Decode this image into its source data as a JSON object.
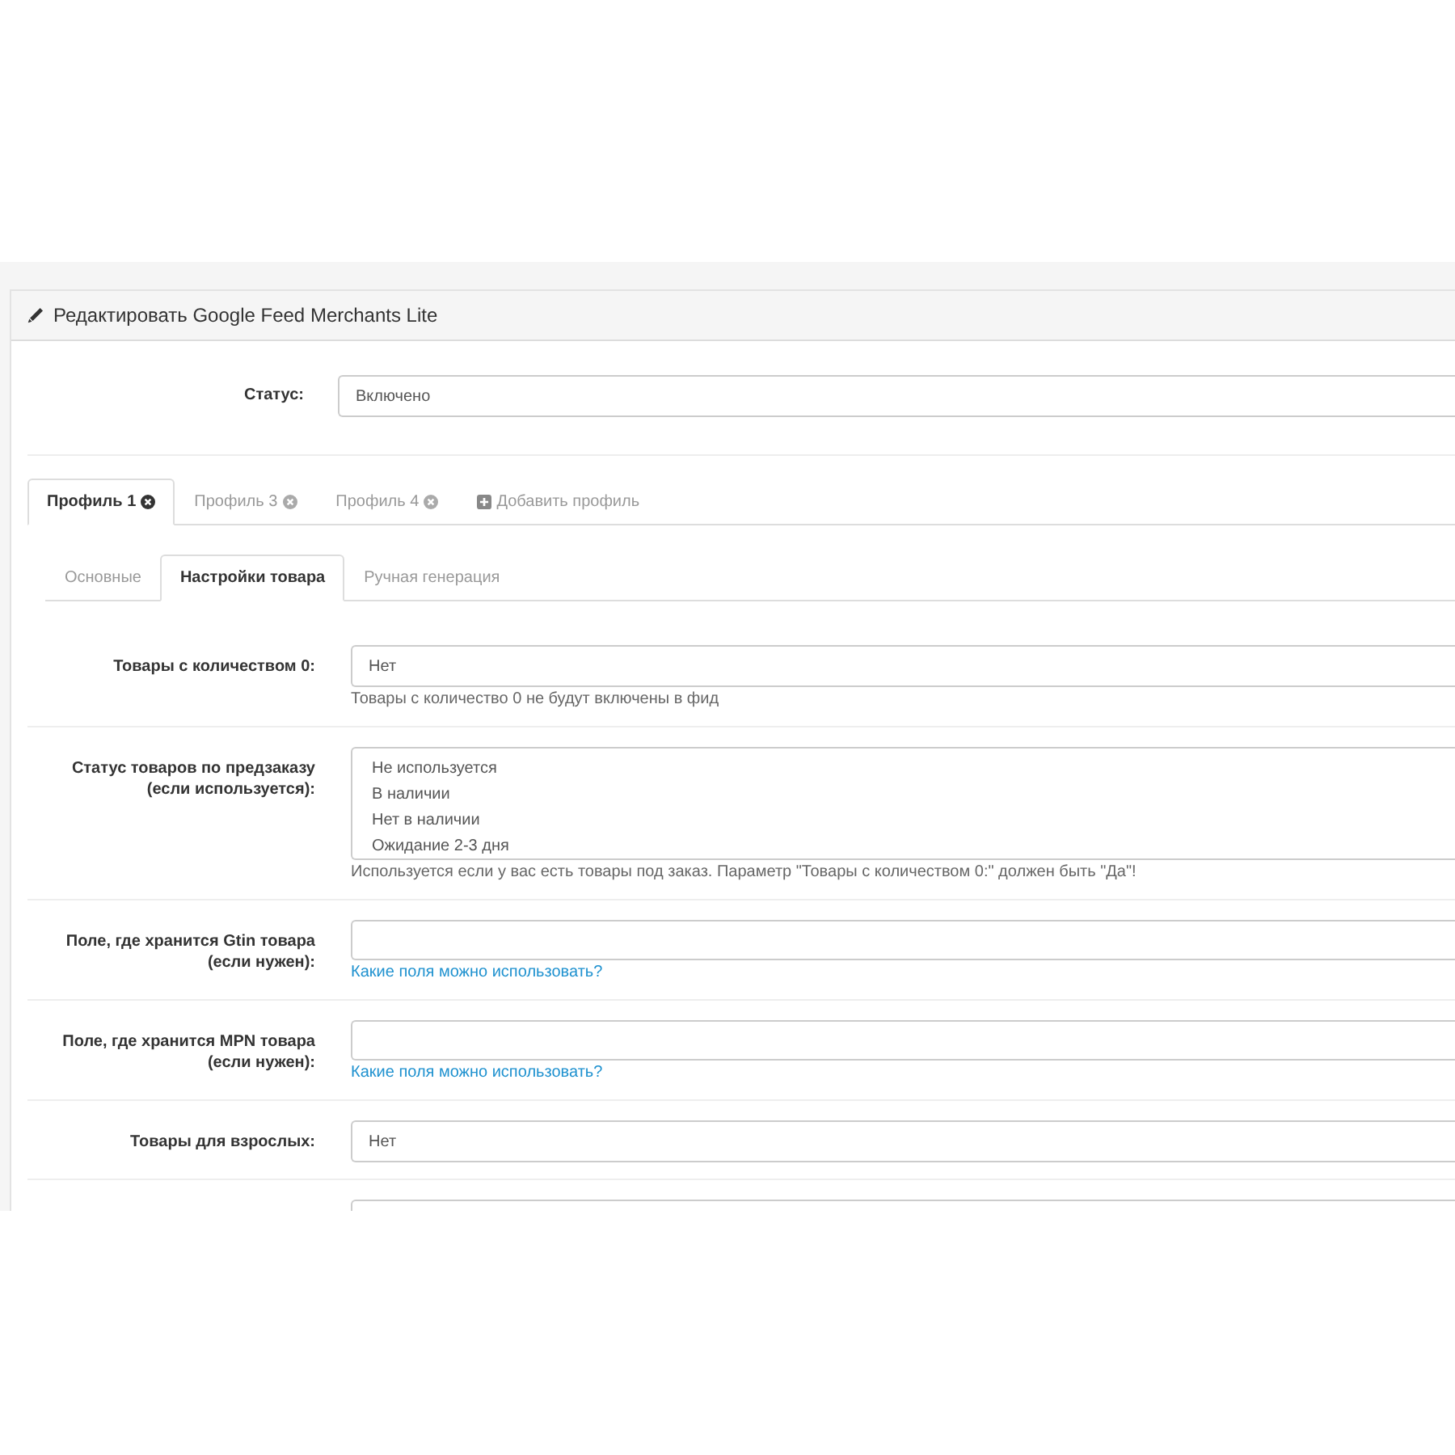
{
  "panel": {
    "title": "Редактировать Google Feed Merchants Lite"
  },
  "status_field": {
    "label": "Статус:",
    "value": "Включено"
  },
  "profile_tabs": [
    {
      "kind": "profile",
      "label": "Профиль 1",
      "selected": true
    },
    {
      "kind": "profile",
      "label": "Профиль 3",
      "selected": false
    },
    {
      "kind": "profile",
      "label": "Профиль 4",
      "selected": false
    },
    {
      "kind": "add",
      "label": "Добавить профиль",
      "selected": false
    }
  ],
  "section_tabs": [
    {
      "label": "Основные",
      "selected": false
    },
    {
      "label": "Настройки товара",
      "selected": true
    },
    {
      "label": "Ручная генерация",
      "selected": false
    }
  ],
  "fields": [
    {
      "kind": "select",
      "label": "Товары с количеством 0:",
      "value": "Нет",
      "help": "Товары с количество 0 не будут включены в фид"
    },
    {
      "kind": "listbox",
      "label": "Статус товаров по предзаказу\n(если используется):",
      "options": [
        {
          "label": "Не используется",
          "selected": false
        },
        {
          "label": "В наличии",
          "selected": false
        },
        {
          "label": "Нет в наличии",
          "selected": false
        },
        {
          "label": "Ожидание 2-3 дня",
          "selected": false
        }
      ],
      "help": "Используется если у вас есть товары под заказ. Параметр \"Товары с количеством 0:\" должен быть \"Да\"!"
    },
    {
      "kind": "input",
      "label": "Поле, где хранится Gtin товара\n(если нужен):",
      "link": "Какие поля можно использовать?"
    },
    {
      "kind": "input",
      "label": "Поле, где хранится MPN товара\n(если нужен):",
      "link": "Какие поля можно использовать?"
    },
    {
      "kind": "select",
      "label": "Товары для взрослых:",
      "value": "Нет"
    },
    {
      "kind": "input"
    }
  ]
}
